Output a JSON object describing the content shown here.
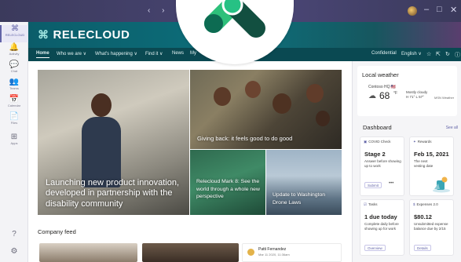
{
  "titlebar": {
    "nav_arrows": "‹ ›",
    "minimize": "–",
    "maximize": "□",
    "close": "✕"
  },
  "rail": [
    {
      "icon": "⌘",
      "label": "RELECLOUD",
      "name": "teams",
      "active": true
    },
    {
      "icon": "🔔",
      "label": "Activity",
      "name": "activity"
    },
    {
      "icon": "💬",
      "label": "Chat",
      "name": "chat"
    },
    {
      "icon": "👥",
      "label": "Teams",
      "name": "teams-app"
    },
    {
      "icon": "📅",
      "label": "Calendar",
      "name": "calendar"
    },
    {
      "icon": "📄",
      "label": "Files",
      "name": "files"
    },
    {
      "icon": "⊞",
      "label": "Apps",
      "name": "apps"
    }
  ],
  "site": {
    "logo_text": "RELECLOUD",
    "nav": [
      "Home",
      "Who we are ∨",
      "What's happening ∨",
      "Find it ∨",
      "News",
      "My"
    ],
    "nav_right": [
      "Confidential",
      "English ∨"
    ]
  },
  "hero": {
    "main_caption": "Launching new product innovation, developed in partnership with the disability community",
    "kids_caption": "Giving back: it feels good to do good",
    "mark_caption": "Relecloud Mark 8: See the world through a whole new perspective",
    "drone_caption": "Update to Washington Drone Laws"
  },
  "feed": {
    "title": "Company feed",
    "author": "Patti Fernandez",
    "date": "Mar 11 2020, 11:36am"
  },
  "weather": {
    "title": "Local weather",
    "location": "Contoso HQ 🇺🇸",
    "temp": "68",
    "unit": "°F",
    "condition": "Mostly cloudy",
    "detail": "H 71° L 57°",
    "source": "MSN Weather"
  },
  "dashboard": {
    "title": "Dashboard",
    "see_all": "See all",
    "cards": [
      {
        "header": "COVID Check",
        "big": "Stage 2",
        "small": "Answer before showing up to work",
        "button": "Submit",
        "more": "•••"
      },
      {
        "header": "Rewards",
        "big": "Feb 15, 2021",
        "small": "The next vesting date"
      },
      {
        "header": "Tasks",
        "big": "1 due today",
        "small": "Complete daily before showing up for work",
        "button": "Overview"
      },
      {
        "header": "Expenses 2.0",
        "big": "$80.12",
        "small": "Unsubmitted expense balance due by 2/15",
        "button": "Details"
      }
    ]
  },
  "colors": {
    "teams_accent": "#6264a7",
    "header_teal": "#0d6f7b",
    "nav_teal": "#0a4952"
  }
}
